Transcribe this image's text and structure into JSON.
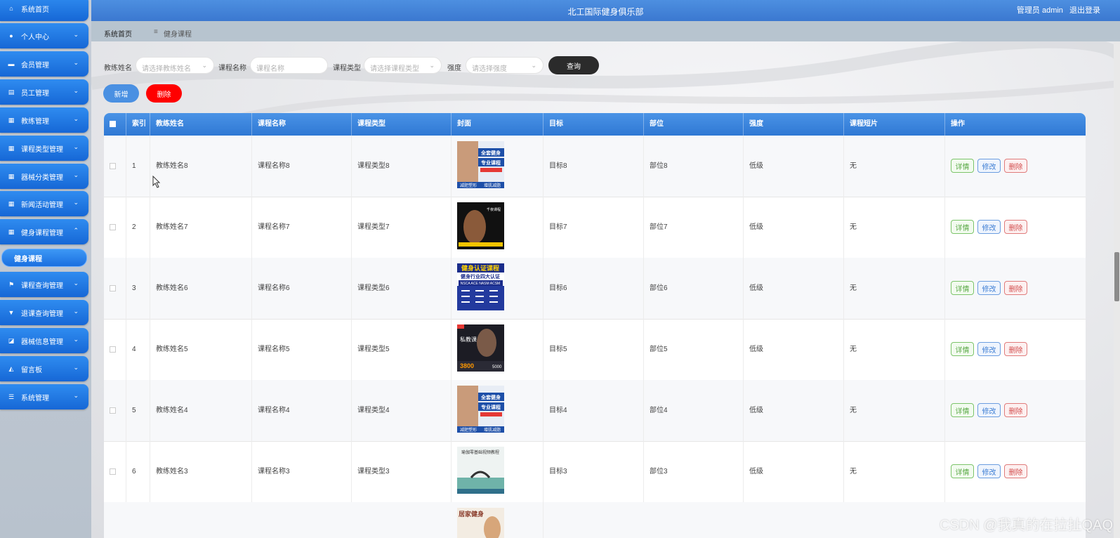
{
  "header": {
    "title": "北工国际健身俱乐部",
    "user_label": "管理员 admin",
    "logout": "退出登录"
  },
  "breadcrumb": {
    "home": "系统首页",
    "sep": "≡",
    "current": "健身课程"
  },
  "sidebar": {
    "items": [
      {
        "label": "系统首页",
        "icon": "home-icon"
      },
      {
        "label": "个人中心",
        "icon": "user-icon"
      },
      {
        "label": "会员管理",
        "icon": "monitor-icon"
      },
      {
        "label": "员工管理",
        "icon": "clipboard-icon"
      },
      {
        "label": "教练管理",
        "icon": "grid-icon"
      },
      {
        "label": "课程类型管理",
        "icon": "table-icon"
      },
      {
        "label": "器械分类管理",
        "icon": "grid-icon"
      },
      {
        "label": "新闻活动管理",
        "icon": "grid-icon"
      },
      {
        "label": "健身课程管理",
        "icon": "grid-icon"
      },
      {
        "label": "课程查询管理",
        "icon": "flag-icon"
      },
      {
        "label": "退课查询管理",
        "icon": "speech-icon"
      },
      {
        "label": "器械信息管理",
        "icon": "chart-icon"
      },
      {
        "label": "留言板",
        "icon": "message-icon"
      },
      {
        "label": "系统管理",
        "icon": "list-icon"
      }
    ],
    "active_sub": "健身课程"
  },
  "search": {
    "coach_label": "教练姓名",
    "coach_placeholder": "请选择教练姓名",
    "course_label": "课程名称",
    "course_placeholder": "课程名称",
    "type_label": "课程类型",
    "type_placeholder": "请选择课程类型",
    "intensity_label": "强度",
    "intensity_placeholder": "请选择强度",
    "query_button": "查询"
  },
  "actions": {
    "add": "新增",
    "delete": "删除"
  },
  "table": {
    "columns": [
      "索引",
      "教练姓名",
      "课程名称",
      "课程类型",
      "封面",
      "目标",
      "部位",
      "强度",
      "课程短片",
      "操作"
    ],
    "rows": [
      {
        "index": "1",
        "coach": "教练姓名8",
        "course": "课程名称8",
        "type": "课程类型8",
        "target": "目标8",
        "part": "部位8",
        "intensity": "低级",
        "video": "无",
        "cover": "poster-a"
      },
      {
        "index": "2",
        "coach": "教练姓名7",
        "course": "课程名称7",
        "type": "课程类型7",
        "target": "目标7",
        "part": "部位7",
        "intensity": "低级",
        "video": "无",
        "cover": "poster-b"
      },
      {
        "index": "3",
        "coach": "教练姓名6",
        "course": "课程名称6",
        "type": "课程类型6",
        "target": "目标6",
        "part": "部位6",
        "intensity": "低级",
        "video": "无",
        "cover": "poster-c"
      },
      {
        "index": "4",
        "coach": "教练姓名5",
        "course": "课程名称5",
        "type": "课程类型5",
        "target": "目标5",
        "part": "部位5",
        "intensity": "低级",
        "video": "无",
        "cover": "poster-d"
      },
      {
        "index": "5",
        "coach": "教练姓名4",
        "course": "课程名称4",
        "type": "课程类型4",
        "target": "目标4",
        "part": "部位4",
        "intensity": "低级",
        "video": "无",
        "cover": "poster-a"
      },
      {
        "index": "6",
        "coach": "教练姓名3",
        "course": "课程名称3",
        "type": "课程类型3",
        "target": "目标3",
        "part": "部位3",
        "intensity": "低级",
        "video": "无",
        "cover": "poster-e"
      }
    ],
    "row_actions": {
      "detail": "详情",
      "edit": "修改",
      "delete": "删除"
    },
    "poster_text": {
      "a1": "全套健身",
      "a2": "专业课程",
      "a3": "减肥塑形",
      "a4": "增肌减脂",
      "b1": "千夜课程",
      "c1": "健身认证课程",
      "c2": "健身行业四大认证",
      "c3": "NSCA ACE NASM ACSM",
      "d1": "私教课",
      "d2": "3800",
      "d3": "5000",
      "e1": "瑜伽零基础视频教程",
      "f1": "居家健身"
    }
  },
  "watermark": "CSDN @我真的在拉扯QAQ"
}
